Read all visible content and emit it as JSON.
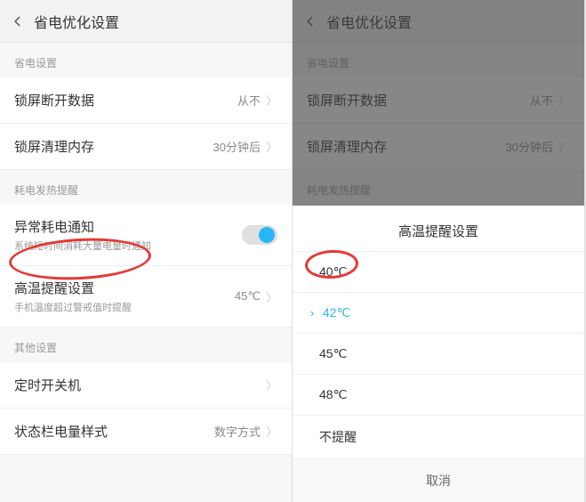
{
  "header": {
    "title": "省电优化设置"
  },
  "sections": {
    "power": "省电设置",
    "heat": "耗电发热提醒",
    "other": "其他设置"
  },
  "rows": {
    "lockscreen_data": {
      "title": "锁屏断开数据",
      "value": "从不"
    },
    "lockscreen_ram": {
      "title": "锁屏清理内存",
      "value": "30分钟后"
    },
    "abnormal": {
      "title": "异常耗电通知",
      "sub": "系统短时间消耗大量电量时通知"
    },
    "high_temp": {
      "title": "高温提醒设置",
      "sub": "手机温度超过警戒值时提醒",
      "value": "45℃"
    },
    "timer": {
      "title": "定时开关机"
    },
    "battery_style": {
      "title": "状态栏电量样式",
      "value": "数字方式"
    }
  },
  "sheet": {
    "title": "高温提醒设置",
    "options": [
      "40℃",
      "42℃",
      "45℃",
      "48℃",
      "不提醒"
    ],
    "cancel": "取消"
  }
}
